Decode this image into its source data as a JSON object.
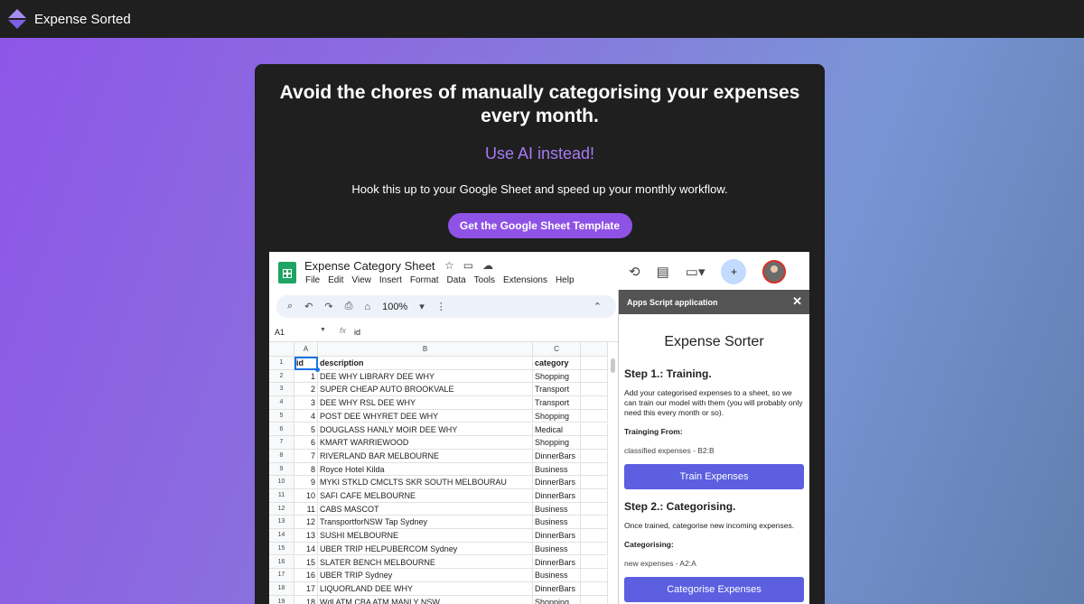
{
  "nav": {
    "brand": "Expense Sorted"
  },
  "hero": {
    "title": "Avoid the chores of manually categorising your expenses every month.",
    "accent": "Use AI instead!",
    "subtitle": "Hook this up to your Google Sheet and speed up your monthly workflow.",
    "cta": "Get the Google Sheet Template"
  },
  "sheet": {
    "doc_title": "Expense Category Sheet",
    "menus": [
      "File",
      "Edit",
      "View",
      "Insert",
      "Format",
      "Data",
      "Tools",
      "Extensions",
      "Help"
    ],
    "zoom": "100%",
    "name_box": "A1",
    "fx_symbol": "fx",
    "formula_value": "id",
    "columns": [
      "A",
      "B",
      "C"
    ],
    "rows": [
      {
        "n": "1",
        "id": "id",
        "description": "description",
        "category": "category"
      },
      {
        "n": "2",
        "id": "1",
        "description": "DEE WHY LIBRARY DEE WHY",
        "category": "Shopping"
      },
      {
        "n": "3",
        "id": "2",
        "description": "SUPER CHEAP AUTO BROOKVALE",
        "category": "Transport"
      },
      {
        "n": "4",
        "id": "3",
        "description": "DEE WHY RSL DEE WHY",
        "category": "Transport"
      },
      {
        "n": "5",
        "id": "4",
        "description": "POST DEE WHYRET DEE WHY",
        "category": "Shopping"
      },
      {
        "n": "6",
        "id": "5",
        "description": "DOUGLASS HANLY MOIR DEE WHY",
        "category": "Medical"
      },
      {
        "n": "7",
        "id": "6",
        "description": "KMART WARRIEWOOD",
        "category": "Shopping"
      },
      {
        "n": "8",
        "id": "7",
        "description": "RIVERLAND BAR MELBOURNE",
        "category": "DinnerBars"
      },
      {
        "n": "9",
        "id": "8",
        "description": "Royce Hotel Kilda",
        "category": "Business"
      },
      {
        "n": "10",
        "id": "9",
        "description": "MYKI STKLD CMCLTS SKR SOUTH MELBOURAU",
        "category": "DinnerBars"
      },
      {
        "n": "11",
        "id": "10",
        "description": "SAFI CAFE MELBOURNE",
        "category": "DinnerBars"
      },
      {
        "n": "12",
        "id": "11",
        "description": "CABS MASCOT",
        "category": "Business"
      },
      {
        "n": "13",
        "id": "12",
        "description": "TransportforNSW Tap Sydney",
        "category": "Business"
      },
      {
        "n": "14",
        "id": "13",
        "description": "SUSHI MELBOURNE",
        "category": "DinnerBars"
      },
      {
        "n": "15",
        "id": "14",
        "description": "UBER TRIP HELPUBERCOM Sydney",
        "category": "Business"
      },
      {
        "n": "16",
        "id": "15",
        "description": "SLATER BENCH MELBOURNE",
        "category": "DinnerBars"
      },
      {
        "n": "17",
        "id": "16",
        "description": "UBER TRIP Sydney",
        "category": "Business"
      },
      {
        "n": "18",
        "id": "17",
        "description": "LIQUORLAND DEE WHY",
        "category": "DinnerBars"
      },
      {
        "n": "19",
        "id": "18",
        "description": "Wdl ATM CBA ATM MANLY NSW",
        "category": "Shopping"
      }
    ]
  },
  "panel": {
    "header": "Apps Script application",
    "close": "✕",
    "title": "Expense Sorter",
    "step1_title": "Step 1.: Training.",
    "step1_desc": "Add your categorised expenses to a sheet, so we can train our model with them (you will probably only need this every month or so).",
    "step1_label": "Trainging From:",
    "step1_range": "classified expenses - B2:B",
    "step1_button": "Train Expenses",
    "step2_title": "Step 2.: Categorising.",
    "step2_desc": "Once trained, categorise new incoming expenses.",
    "step2_label": "Categorising:",
    "step2_range": "new expenses - A2:A",
    "step2_button": "Categorise Expenses"
  },
  "icons": {
    "logo": "diamond-logo-icon",
    "star": "star-icon",
    "move": "folder-move-icon",
    "cloud": "cloud-saved-icon",
    "history": "history-icon",
    "comments": "comments-icon",
    "meet": "video-call-icon",
    "share": "add-person-icon"
  },
  "colors": {
    "accent": "#a77af4",
    "cta": "#8f52e6",
    "panel_button": "#5b5fe0"
  }
}
